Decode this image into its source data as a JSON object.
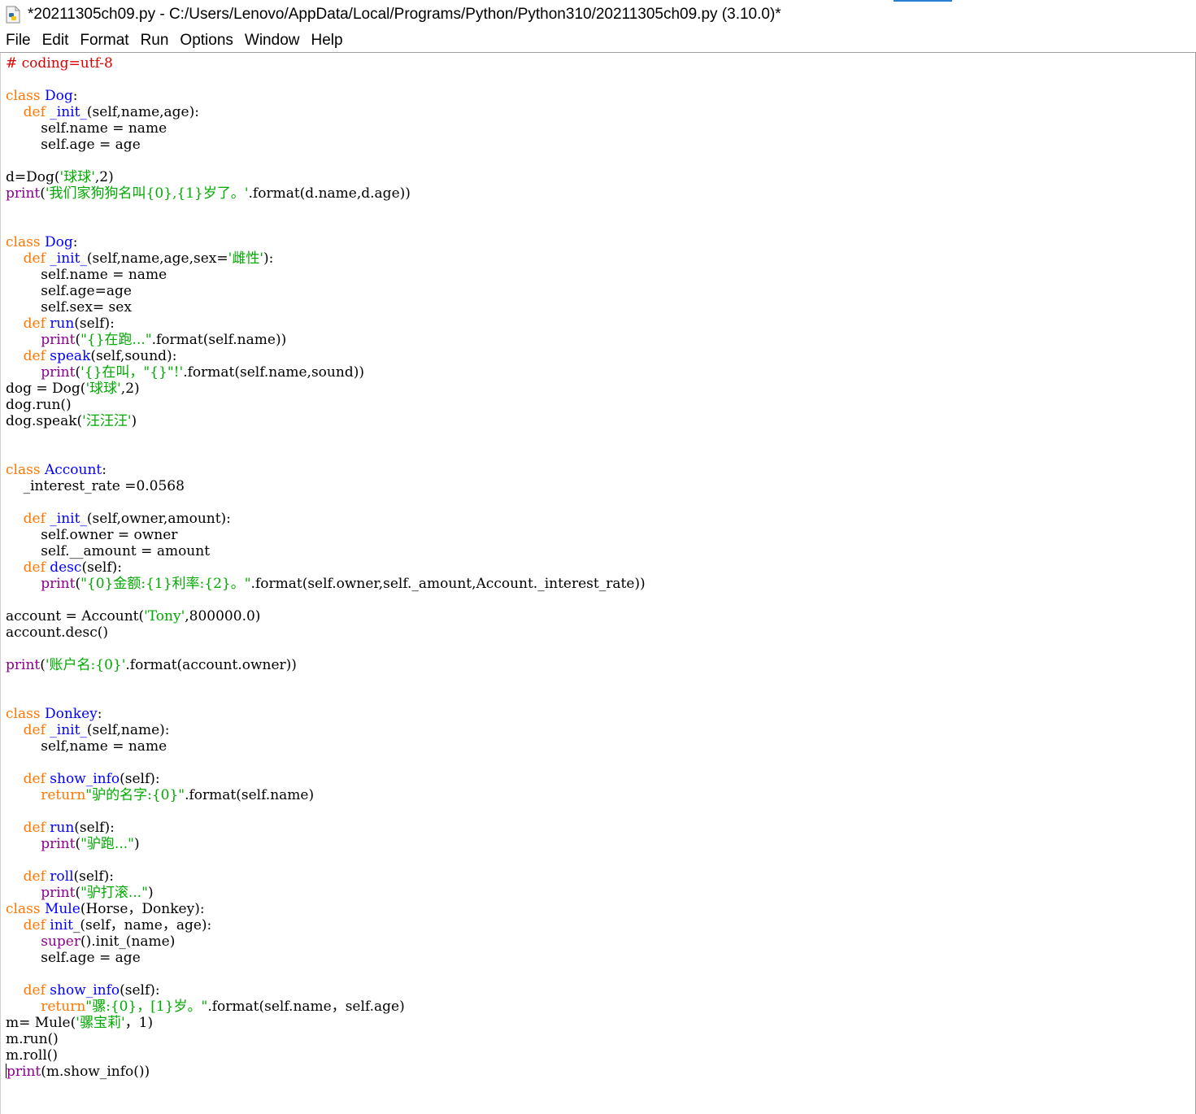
{
  "window": {
    "title": "*20211305ch09.py - C:/Users/Lenovo/AppData/Local/Programs/Python/Python310/20211305ch09.py (3.10.0)*",
    "icon": "python-file-icon"
  },
  "menu": [
    "File",
    "Edit",
    "Format",
    "Run",
    "Options",
    "Window",
    "Help"
  ],
  "code_lines": [
    [
      [
        "cmt",
        "# coding=utf-8"
      ]
    ],
    [],
    [
      [
        "kw",
        "class "
      ],
      [
        "def",
        "Dog"
      ],
      [
        "",
        ":"
      ]
    ],
    [
      [
        "",
        "    "
      ],
      [
        "kw",
        "def "
      ],
      [
        "def",
        "_init_"
      ],
      [
        "",
        "(self,name,age):"
      ]
    ],
    [
      [
        "",
        "        self.name = name"
      ]
    ],
    [
      [
        "",
        "        self.age = age"
      ]
    ],
    [],
    [
      [
        "",
        "d=Dog("
      ],
      [
        "str",
        "'球球'"
      ],
      [
        "",
        ",2)"
      ]
    ],
    [
      [
        "bi",
        "print"
      ],
      [
        "",
        "("
      ],
      [
        "str",
        "'我们家狗狗名叫{0},{1}岁了。'"
      ],
      [
        "",
        ".format(d.name,d.age))"
      ]
    ],
    [],
    [],
    [
      [
        "kw",
        "class "
      ],
      [
        "def",
        "Dog"
      ],
      [
        "",
        ":"
      ]
    ],
    [
      [
        "",
        "    "
      ],
      [
        "kw",
        "def "
      ],
      [
        "def",
        "_init_"
      ],
      [
        "",
        "(self,name,age,sex="
      ],
      [
        "str",
        "'雌性'"
      ],
      [
        "",
        "):"
      ]
    ],
    [
      [
        "",
        "        self.name = name"
      ]
    ],
    [
      [
        "",
        "        self.age=age"
      ]
    ],
    [
      [
        "",
        "        self.sex= sex"
      ]
    ],
    [
      [
        "",
        "    "
      ],
      [
        "kw",
        "def "
      ],
      [
        "def",
        "run"
      ],
      [
        "",
        "(self):"
      ]
    ],
    [
      [
        "",
        "        "
      ],
      [
        "bi",
        "print"
      ],
      [
        "",
        "("
      ],
      [
        "str",
        "\"{}在跑...\""
      ],
      [
        "",
        ".format(self.name))"
      ]
    ],
    [
      [
        "",
        "    "
      ],
      [
        "kw",
        "def "
      ],
      [
        "def",
        "speak"
      ],
      [
        "",
        "(self,sound):"
      ]
    ],
    [
      [
        "",
        "        "
      ],
      [
        "bi",
        "print"
      ],
      [
        "",
        "("
      ],
      [
        "str",
        "'{}在叫，\"{}\"!'"
      ],
      [
        "",
        ".format(self.name,sound))"
      ]
    ],
    [
      [
        "",
        "dog = Dog("
      ],
      [
        "str",
        "'球球'"
      ],
      [
        "",
        ",2)"
      ]
    ],
    [
      [
        "",
        "dog.run()"
      ]
    ],
    [
      [
        "",
        "dog.speak("
      ],
      [
        "str",
        "'汪汪汪'"
      ],
      [
        "",
        ")"
      ]
    ],
    [],
    [],
    [
      [
        "kw",
        "class "
      ],
      [
        "def",
        "Account"
      ],
      [
        "",
        ":"
      ]
    ],
    [
      [
        "",
        "    _interest_rate =0.0568"
      ]
    ],
    [],
    [
      [
        "",
        "    "
      ],
      [
        "kw",
        "def "
      ],
      [
        "def",
        "_init_"
      ],
      [
        "",
        "(self,owner,amount):"
      ]
    ],
    [
      [
        "",
        "        self.owner = owner"
      ]
    ],
    [
      [
        "",
        "        self.__amount = amount"
      ]
    ],
    [
      [
        "",
        "    "
      ],
      [
        "kw",
        "def "
      ],
      [
        "def",
        "desc"
      ],
      [
        "",
        "(self):"
      ]
    ],
    [
      [
        "",
        "        "
      ],
      [
        "bi",
        "print"
      ],
      [
        "",
        "("
      ],
      [
        "str",
        "\"{0}金额:{1}利率:{2}。\""
      ],
      [
        "",
        ".format(self.owner,self._amount,Account._interest_rate))"
      ]
    ],
    [],
    [
      [
        "",
        "account = Account("
      ],
      [
        "str",
        "'Tony'"
      ],
      [
        "",
        ",800000.0)"
      ]
    ],
    [
      [
        "",
        "account.desc()"
      ]
    ],
    [],
    [
      [
        "bi",
        "print"
      ],
      [
        "",
        "("
      ],
      [
        "str",
        "'账户名:{0}'"
      ],
      [
        "",
        ".format(account.owner))"
      ]
    ],
    [],
    [],
    [
      [
        "kw",
        "class "
      ],
      [
        "def",
        "Donkey"
      ],
      [
        "",
        ":"
      ]
    ],
    [
      [
        "",
        "    "
      ],
      [
        "kw",
        "def "
      ],
      [
        "def",
        "_init_"
      ],
      [
        "",
        "(self,name):"
      ]
    ],
    [
      [
        "",
        "        self,name = name"
      ]
    ],
    [],
    [
      [
        "",
        "    "
      ],
      [
        "kw",
        "def "
      ],
      [
        "def",
        "show_info"
      ],
      [
        "",
        "(self):"
      ]
    ],
    [
      [
        "",
        "        "
      ],
      [
        "kw",
        "return"
      ],
      [
        "str",
        "\"驴的名字:{0}\""
      ],
      [
        "",
        ".format(self.name)"
      ]
    ],
    [],
    [
      [
        "",
        "    "
      ],
      [
        "kw",
        "def "
      ],
      [
        "def",
        "run"
      ],
      [
        "",
        "(self):"
      ]
    ],
    [
      [
        "",
        "        "
      ],
      [
        "bi",
        "print"
      ],
      [
        "",
        "("
      ],
      [
        "str",
        "\"驴跑...\""
      ],
      [
        "",
        ")"
      ]
    ],
    [],
    [
      [
        "",
        "    "
      ],
      [
        "kw",
        "def "
      ],
      [
        "def",
        "roll"
      ],
      [
        "",
        "(self):"
      ]
    ],
    [
      [
        "",
        "        "
      ],
      [
        "bi",
        "print"
      ],
      [
        "",
        "("
      ],
      [
        "str",
        "\"驴打滚...\""
      ],
      [
        "",
        ")"
      ]
    ],
    [
      [
        "kw",
        "class "
      ],
      [
        "def",
        "Mule"
      ],
      [
        "",
        "(Horse，Donkey):"
      ]
    ],
    [
      [
        "",
        "    "
      ],
      [
        "kw",
        "def "
      ],
      [
        "def",
        "init"
      ],
      [
        "",
        "_(self，name，age):"
      ]
    ],
    [
      [
        "",
        "        "
      ],
      [
        "bi",
        "super"
      ],
      [
        "",
        "().init_(name)"
      ]
    ],
    [
      [
        "",
        "        self.age = age"
      ]
    ],
    [],
    [
      [
        "",
        "    "
      ],
      [
        "kw",
        "def "
      ],
      [
        "def",
        "show_info"
      ],
      [
        "",
        "(self):"
      ]
    ],
    [
      [
        "",
        "        "
      ],
      [
        "kw",
        "return"
      ],
      [
        "str",
        "\"骡:{0}，[1}岁。\""
      ],
      [
        "",
        ".format(self.name，self.age)"
      ]
    ],
    [
      [
        "",
        "m= Mule("
      ],
      [
        "str",
        "'骡宝莉'"
      ],
      [
        "",
        "，1)"
      ]
    ],
    [
      [
        "",
        "m.run()"
      ]
    ],
    [
      [
        "",
        "m.roll()"
      ]
    ],
    [
      [
        "cursor",
        ""
      ],
      [
        "bi",
        "print"
      ],
      [
        "",
        "(m.show_info())"
      ]
    ]
  ],
  "colors": {
    "keyword": "#ff7700",
    "definition": "#0000ff",
    "builtin": "#900090",
    "string": "#00aa00",
    "comment": "#dd0000"
  }
}
